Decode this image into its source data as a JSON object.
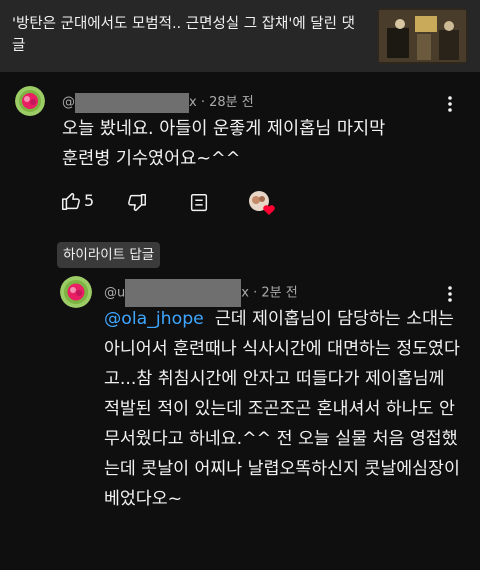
{
  "video": {
    "title": "'방탄은 군대에서도 모범적.. 근면성실 그 잡채'에 달린 댓글"
  },
  "comment": {
    "author_prefix": "@",
    "author_suffix": "x",
    "separator": "·",
    "time": "28분 전",
    "text": "오늘 봤네요. 아들이 운좋게 제이홉님 마지막 훈련병 기수였어요~^^",
    "like_count": "5"
  },
  "reply": {
    "chip_label": "하이라이트 답글",
    "author_prefix": "@u",
    "author_suffix": "x",
    "separator": "·",
    "time": "2분 전",
    "mention": "@ola_jhope",
    "text": "  근데 제이홉님이 담당하는 소대는 아니어서 훈련때나 식사시간에 대면하는 정도였다고...참 취침시간에 안자고 떠들다가 제이홉님께 적발된 적이 있는데 조곤조곤 혼내셔서 하나도 안무서웠다고 하네요.^^ 전 오늘 실물 처음 영접했는데 콧날이 어찌나 날렵오똑하신지 콧날에심장이 베었다오~"
  },
  "icons": {
    "like": "thumbs-up-icon",
    "dislike": "thumbs-down-icon",
    "reply": "reply-comment-icon",
    "creator_heart": "creator-heart-icon",
    "more": "more-vert-icon"
  },
  "colors": {
    "background": "#0f0f0f",
    "header": "#272727",
    "mention": "#3ea6ff",
    "heart": "#ff0033",
    "avatar": "#8bc34a"
  }
}
